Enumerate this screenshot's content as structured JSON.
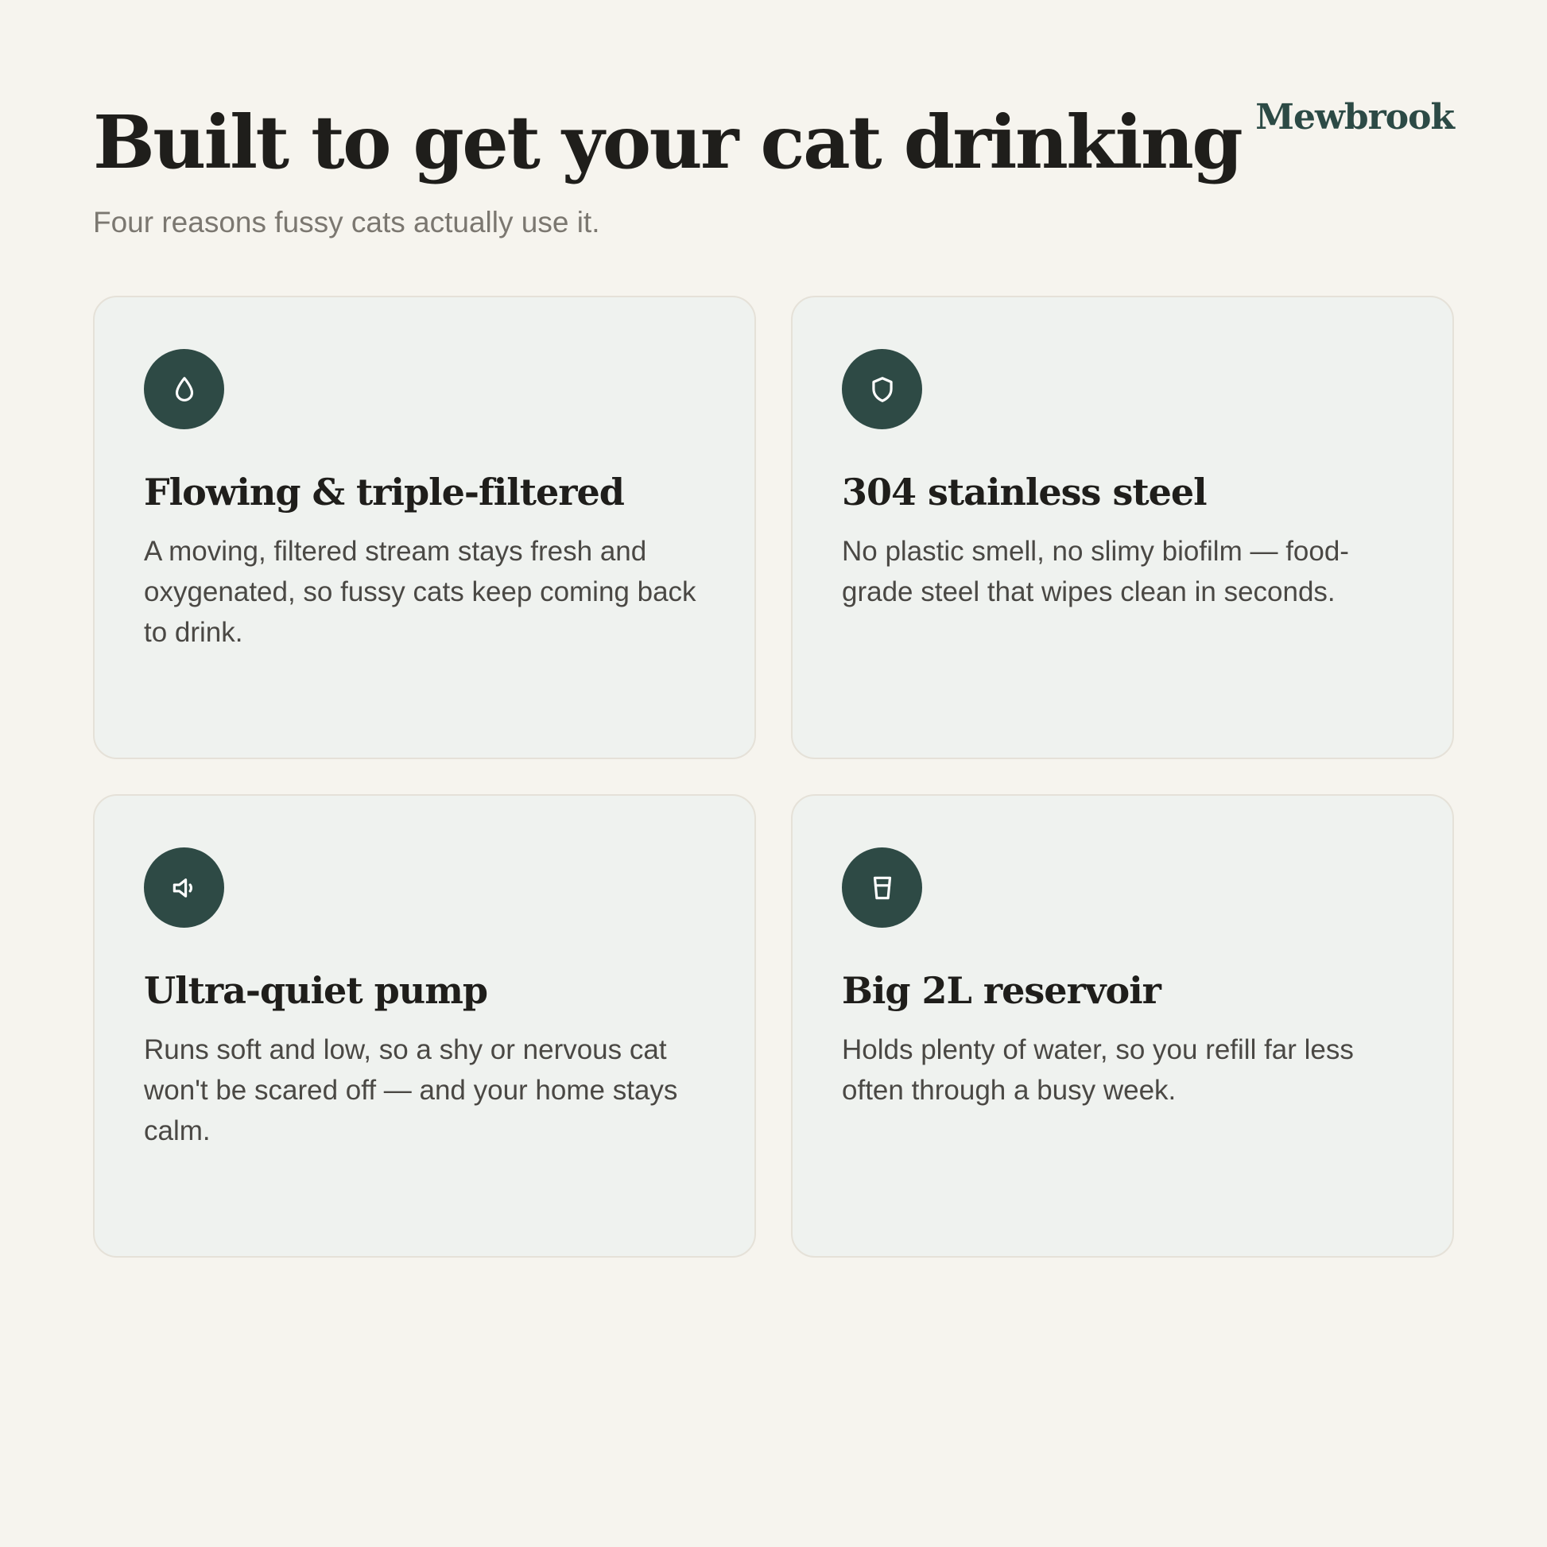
{
  "header": {
    "title": "Built to get your cat drinking",
    "subtitle": "Four reasons fussy cats actually use it.",
    "brand": "Mewbrook"
  },
  "colors": {
    "background": "#f6f4ee",
    "card_background": "#eff2ef",
    "accent": "#2e4a45",
    "brand": "#2c4a45"
  },
  "features": [
    {
      "icon": "water-drop-icon",
      "title": "Flowing & triple-filtered",
      "description": "A moving, filtered stream stays fresh and oxygenated, so fussy cats keep coming back to drink."
    },
    {
      "icon": "shield-icon",
      "title": "304 stainless steel",
      "description": "No plastic smell, no slimy biofilm — food-grade steel that wipes clean in seconds."
    },
    {
      "icon": "speaker-quiet-icon",
      "title": "Ultra-quiet pump",
      "description": "Runs soft and low, so a shy or nervous cat won't be scared off — and your home stays calm."
    },
    {
      "icon": "water-cup-icon",
      "title": "Big 2L reservoir",
      "description": "Holds plenty of water, so you refill far less often through a busy week."
    }
  ]
}
